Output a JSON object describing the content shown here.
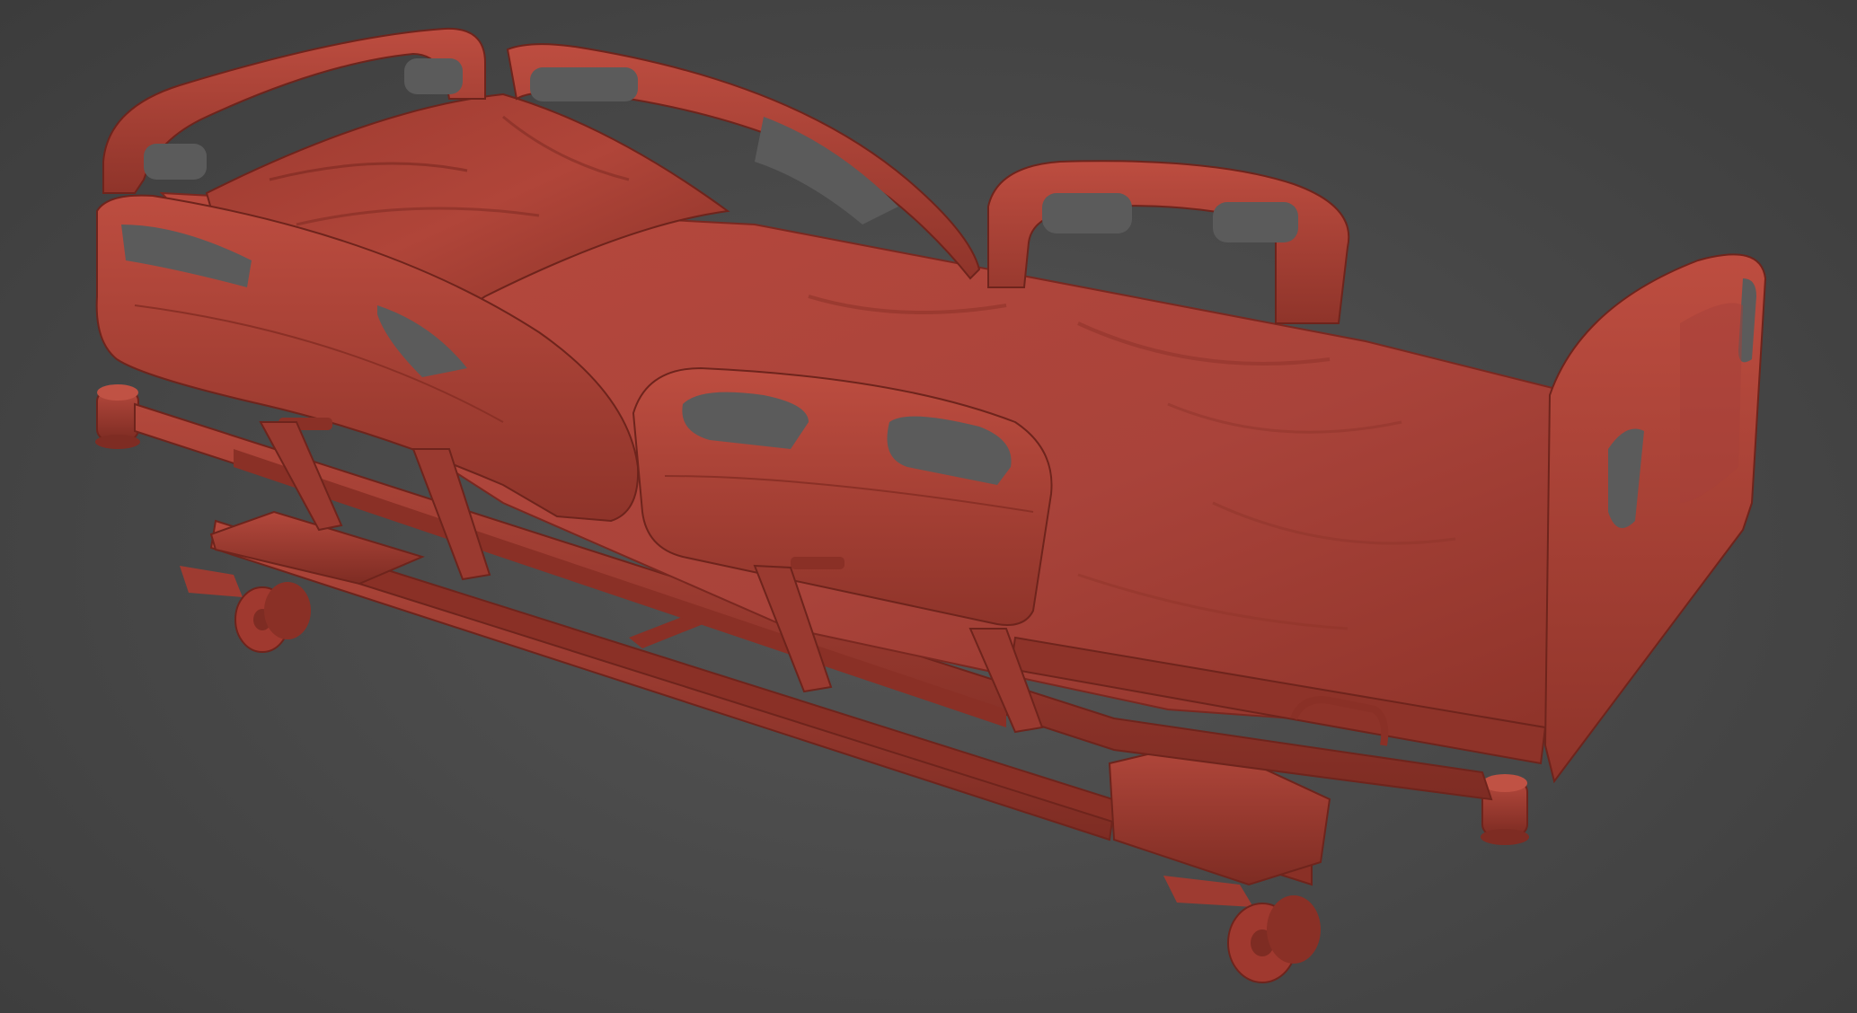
{
  "viewport": {
    "background_color": "#474747",
    "model_color": "#b0453a",
    "model_shadow_color": "#7a2820",
    "model_highlight_color": "#c95a4c"
  },
  "scene": {
    "subject": "hospital-bed-3d-model",
    "parts": [
      "headboard",
      "footboard",
      "head-side-rails",
      "foot-side-rails",
      "mattress",
      "pillow",
      "frame",
      "casters"
    ]
  }
}
